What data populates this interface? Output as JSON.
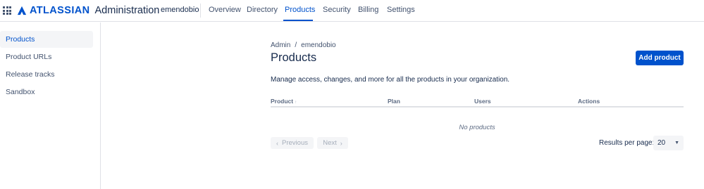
{
  "header": {
    "brand": "ATLASSIAN",
    "product": "Administration",
    "org": "emendobio",
    "tabs": [
      {
        "label": "Overview",
        "active": false
      },
      {
        "label": "Directory",
        "active": false
      },
      {
        "label": "Products",
        "active": true
      },
      {
        "label": "Security",
        "active": false
      },
      {
        "label": "Billing",
        "active": false
      },
      {
        "label": "Settings",
        "active": false
      }
    ]
  },
  "sidebar": {
    "items": [
      {
        "label": "Products",
        "active": true
      },
      {
        "label": "Product URLs",
        "active": false
      },
      {
        "label": "Release tracks",
        "active": false
      },
      {
        "label": "Sandbox",
        "active": false
      }
    ]
  },
  "main": {
    "breadcrumb": [
      "Admin",
      "/",
      "emendobio"
    ],
    "title": "Products",
    "add_button": "Add product",
    "description": "Manage access, changes, and more for all the products in your organization.",
    "table": {
      "columns": [
        "Product",
        "Plan",
        "Users",
        "Actions"
      ],
      "sort_indicator": "↑",
      "empty_message": "No products"
    },
    "pagination": {
      "previous": "Previous",
      "next": "Next",
      "results_label": "Results per page:",
      "results_value": "20"
    }
  },
  "icons": {
    "app_switcher": "grid-icon",
    "logo": "atlassian-logo-icon",
    "prev": "chevron-left-icon",
    "next": "chevron-right-icon",
    "dropdown": "chevron-down-icon"
  },
  "colors": {
    "accent": "#0052cc",
    "text": "#172b4d",
    "muted": "#42526e",
    "border": "#dfe1e6",
    "subtle_bg": "#f4f5f7"
  }
}
